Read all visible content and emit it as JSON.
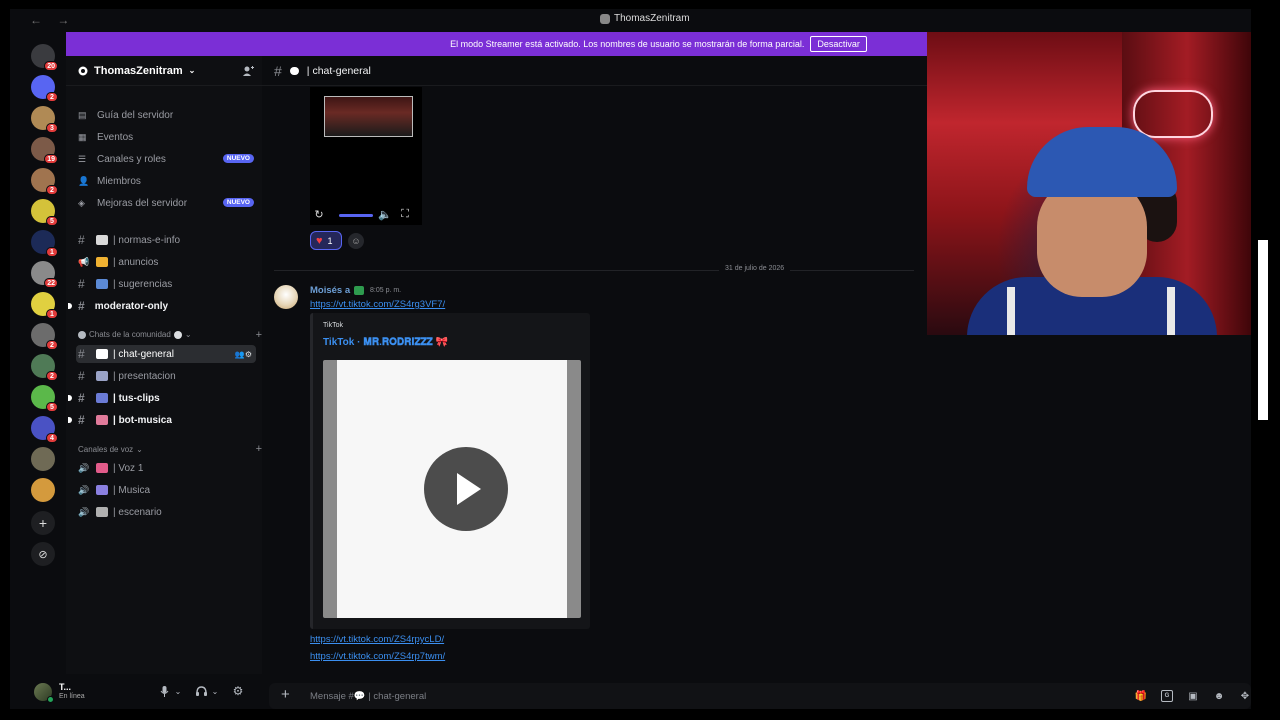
{
  "window": {
    "title": "ThomasZenitram",
    "nav": "← →"
  },
  "banner": {
    "text": "El modo Streamer está activado. Los nombres de usuario se mostrarán de forma parcial.",
    "button": "Desactivar",
    "color": "#7b2fd6"
  },
  "guilds": {
    "items": [
      {
        "badge": "20",
        "color": "#3a3b3f"
      },
      {
        "badge": "2",
        "color": "#5865f2"
      },
      {
        "badge": "3",
        "color": "#b08a55"
      },
      {
        "badge": "19",
        "color": "#7c5a48"
      },
      {
        "badge": "2",
        "color": "#a0744f"
      },
      {
        "badge": "5",
        "color": "#d4c23a"
      },
      {
        "badge": "1",
        "color": "#1c2a57"
      },
      {
        "badge": "22",
        "color": "#8a8a8a"
      },
      {
        "badge": "1",
        "color": "#e0d040"
      },
      {
        "badge": "2",
        "color": "#6c6c6c"
      },
      {
        "badge": "2",
        "color": "#4f7a56"
      },
      {
        "badge": "5",
        "color": "#5bb84a"
      },
      {
        "badge": "4",
        "color": "#4a52c4"
      },
      {
        "badge": "",
        "color": "#6f6a55"
      },
      {
        "badge": "",
        "color": "#d49a3d"
      }
    ],
    "add_icon": "+",
    "discover_icon": "compass-icon"
  },
  "server": {
    "name": "ThomasZenitram",
    "nav_items": [
      {
        "label": "Guía del servidor",
        "icon": "guide-icon"
      },
      {
        "label": "Eventos",
        "icon": "calendar-icon"
      },
      {
        "label": "Canales y roles",
        "icon": "list-icon",
        "badge": "NUEVO"
      },
      {
        "label": "Miembros",
        "icon": "members-icon"
      },
      {
        "label": "Mejoras del servidor",
        "icon": "boost-icon",
        "badge": "NUEVO"
      }
    ],
    "top_channels": [
      {
        "label": "| normas-e-info",
        "emoji_color": "#d9d9d9",
        "bold": false,
        "kind": "rules"
      },
      {
        "label": "| anuncios",
        "emoji_color": "#f0b232",
        "bold": false,
        "kind": "announce"
      },
      {
        "label": "| sugerencias",
        "emoji_color": "#5b8ad6",
        "bold": false,
        "kind": "text"
      },
      {
        "label": "moderator-only",
        "emoji_color": "",
        "bold": true,
        "kind": "text"
      }
    ],
    "community_category": "Chats de la comunidad",
    "community_channels": [
      {
        "label": "| chat-general",
        "emoji_color": "#ffffff",
        "active": true,
        "bold": false
      },
      {
        "label": "| presentacion",
        "emoji_color": "#9aa3c7",
        "active": false,
        "bold": false
      },
      {
        "label": "| tus-clips",
        "emoji_color": "#6b7bd6",
        "active": false,
        "bold": true
      },
      {
        "label": "| bot-musica",
        "emoji_color": "#e07a9a",
        "active": false,
        "bold": true
      }
    ],
    "voice_category": "Canales de voz",
    "voice_channels": [
      {
        "label": "| Voz 1",
        "emoji_color": "#e25b8a"
      },
      {
        "label": "| Musica",
        "emoji_color": "#8a7fe0"
      },
      {
        "label": "| escenario",
        "emoji_color": "#b0b0b0"
      }
    ]
  },
  "user_panel": {
    "name": "T...",
    "status": "En línea"
  },
  "channel": {
    "name": "| chat-general"
  },
  "messages": {
    "reaction_count": "1",
    "date_divider": "31 de julio de 2026",
    "author": "Moisés a",
    "time": "8:05 p. m.",
    "link1": "https://vt.tiktok.com/ZS4rg3VF7/",
    "embed": {
      "provider": "TikTok",
      "title": "TikTok · 𝐌𝐑.𝐑𝐎𝐃𝐑𝐈𝐙𝐙𝐙 🎀"
    },
    "link2": "https://vt.tiktok.com/ZS4rpycLD/",
    "link3": "https://vt.tiktok.com/ZS4rp7twm/"
  },
  "composer": {
    "placeholder": "Mensaje #💬 | chat-general"
  }
}
